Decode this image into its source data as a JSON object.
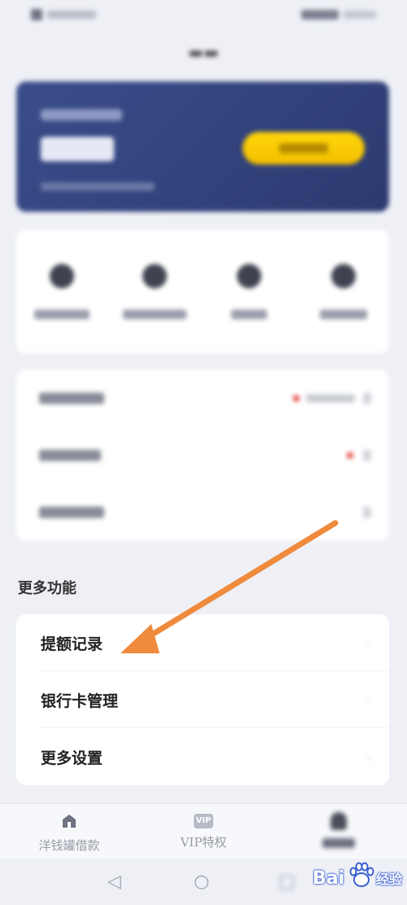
{
  "more_functions": {
    "section_title": "更多功能",
    "items": [
      {
        "label": "提额记录",
        "chevron": "›"
      },
      {
        "label": "银行卡管理",
        "chevron": "›"
      },
      {
        "label": "更多设置",
        "chevron": "›"
      }
    ]
  },
  "bottom_nav": {
    "items": [
      {
        "label": "洋钱罐借款",
        "icon": "home-icon"
      },
      {
        "label": "VIP特权",
        "icon": "vip-icon",
        "badge": "VIP"
      },
      {
        "label": "",
        "icon": "me-icon"
      }
    ]
  },
  "system_nav": {
    "back": "◁",
    "home": "○",
    "recent": "□"
  },
  "watermark": {
    "text": "Bai",
    "suffix": "经验"
  },
  "colors": {
    "card_bg": "#3a4d8a",
    "button_yellow": "#ffd60a",
    "arrow": "#f08a3c",
    "badge_red": "#e04040"
  }
}
